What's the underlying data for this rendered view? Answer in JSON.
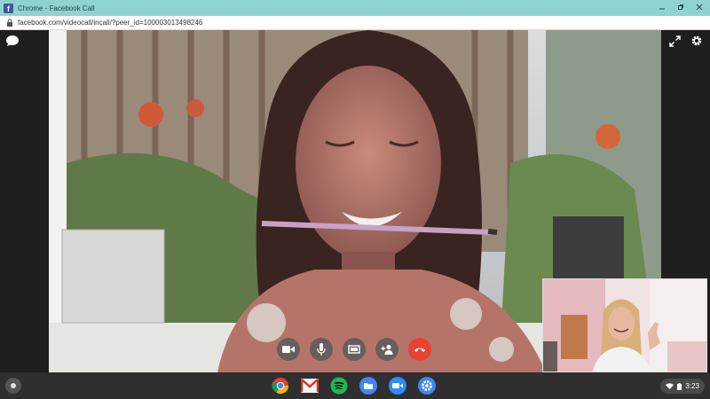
{
  "window": {
    "title": "Chrome - Facebook Call",
    "icon": "facebook-icon"
  },
  "address_bar": {
    "url": "facebook.com/videocall/incall/?peer_id=100003013498246",
    "icon": "lock-icon"
  },
  "call": {
    "top_left_icon": "chat-bubble-icon",
    "top_right_icons": [
      "expand-icon",
      "gear-icon"
    ],
    "controls": [
      {
        "name": "video-button",
        "icon": "video-camera-icon"
      },
      {
        "name": "mute-button",
        "icon": "microphone-icon"
      },
      {
        "name": "screen-share-button",
        "icon": "screen-icon"
      },
      {
        "name": "add-person-button",
        "icon": "add-person-icon"
      },
      {
        "name": "end-call-button",
        "icon": "hang-up-icon",
        "color": "#e94235"
      }
    ]
  },
  "shelf": {
    "apps": [
      "chrome-icon",
      "gmail-icon",
      "spotify-icon",
      "files-icon",
      "zoom-icon",
      "settings-icon"
    ],
    "time": "3:23",
    "status_icons": [
      "wifi-icon",
      "battery-icon"
    ]
  },
  "colors": {
    "titlebar": "#8fd2d0",
    "end_call": "#e94235",
    "shelf": "#2f2f2f"
  }
}
